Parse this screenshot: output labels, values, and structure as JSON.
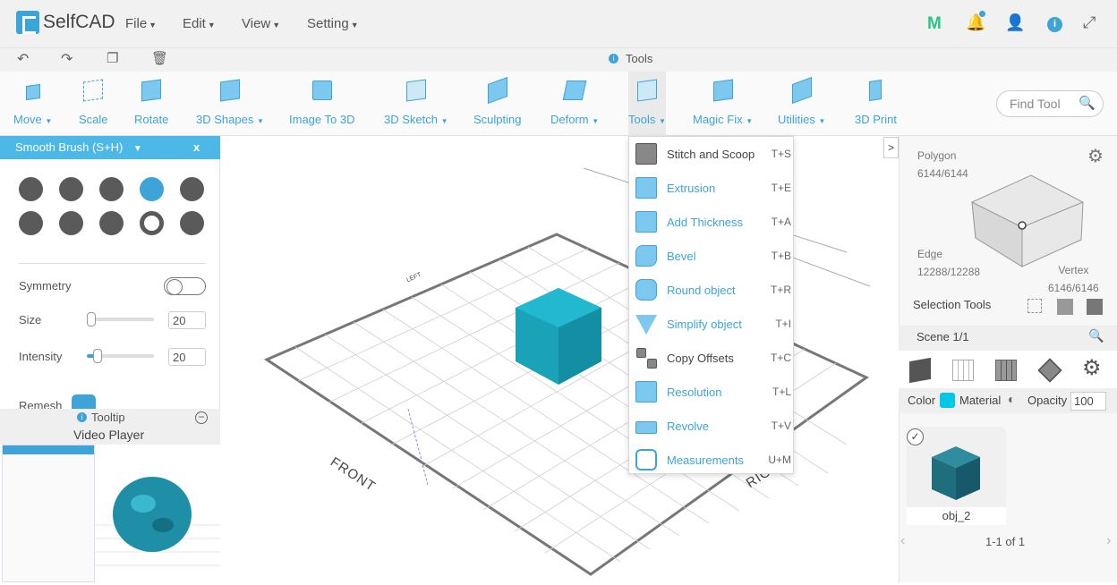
{
  "app": {
    "logo": "SelfCAD"
  },
  "menu": [
    "File",
    "Edit",
    "View",
    "Setting"
  ],
  "tools_label": "Tools",
  "toolbar": [
    {
      "label": "Move",
      "dropdown": true
    },
    {
      "label": "Scale",
      "dropdown": false
    },
    {
      "label": "Rotate",
      "dropdown": false
    },
    {
      "label": "3D Shapes",
      "dropdown": true
    },
    {
      "label": "Image To 3D",
      "dropdown": false
    },
    {
      "label": "3D Sketch",
      "dropdown": true
    },
    {
      "label": "Sculpting",
      "dropdown": false
    },
    {
      "label": "Deform",
      "dropdown": true
    },
    {
      "label": "Tools",
      "dropdown": true
    },
    {
      "label": "Magic Fix",
      "dropdown": true
    },
    {
      "label": "Utilities",
      "dropdown": true
    },
    {
      "label": "3D Print",
      "dropdown": false
    }
  ],
  "find_tool": {
    "placeholder": "Find Tool"
  },
  "brush_panel": {
    "title": "Smooth Brush (S+H)",
    "close": "x",
    "symmetry": "Symmetry",
    "size_label": "Size",
    "size_value": "20",
    "intensity_label": "Intensity",
    "intensity_value": "20",
    "remesh": "Remesh"
  },
  "tooltip": {
    "title": "Tooltip",
    "subtitle": "Video Player"
  },
  "dropdown": [
    {
      "name": "Stitch and Scoop",
      "shortcut": "T+S",
      "style": "gray"
    },
    {
      "name": "Extrusion",
      "shortcut": "T+E",
      "style": "blue"
    },
    {
      "name": "Add Thickness",
      "shortcut": "T+A",
      "style": "blue"
    },
    {
      "name": "Bevel",
      "shortcut": "T+B",
      "style": "blue"
    },
    {
      "name": "Round object",
      "shortcut": "T+R",
      "style": "blue"
    },
    {
      "name": "Simplify object",
      "shortcut": "T+I",
      "style": "blue"
    },
    {
      "name": "Copy Offsets",
      "shortcut": "T+C",
      "style": "gray"
    },
    {
      "name": "Resolution",
      "shortcut": "T+L",
      "style": "blue"
    },
    {
      "name": "Revolve",
      "shortcut": "T+V",
      "style": "blue"
    },
    {
      "name": "Measurements",
      "shortcut": "U+M",
      "style": "blue"
    }
  ],
  "viewport": {
    "front_label": "FRONT",
    "right_label": "RIGH",
    "left_label": "LEFT"
  },
  "selection": {
    "polygon_label": "Polygon",
    "polygon_count": "6144/6144",
    "edge_label": "Edge",
    "edge_count": "12288/12288",
    "vertex_label": "Vertex",
    "vertex_count": "6146/6146",
    "tools_label": "Selection Tools"
  },
  "scene": {
    "title": "Scene 1/1"
  },
  "props": {
    "color_label": "Color",
    "material_label": "Material",
    "opacity_label": "Opacity",
    "opacity_value": "100",
    "color": "#00c8e6"
  },
  "object": {
    "name": "obj_2",
    "pagination": "1-1 of 1"
  },
  "colors": {
    "accent": "#3ea4d8",
    "cube": "#1aa3b8"
  }
}
